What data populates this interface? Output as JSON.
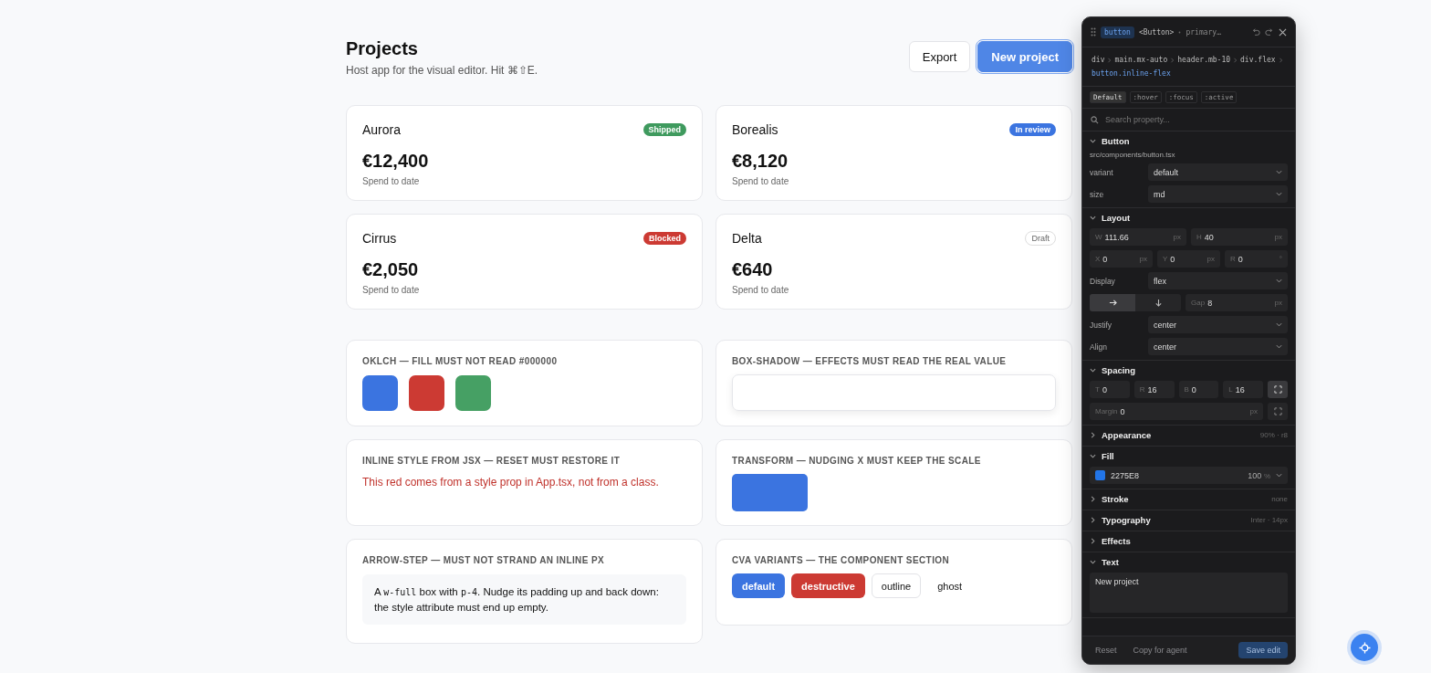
{
  "header": {
    "title": "Projects",
    "subtitle": "Host app for the visual editor. Hit ⌘⇧E.",
    "buttons": [
      {
        "label": "Export",
        "kind": "secondary",
        "selected": false
      },
      {
        "label": "New project",
        "kind": "primary",
        "selected": true
      }
    ]
  },
  "projects": [
    {
      "name": "Aurora",
      "status": "Shipped",
      "color": "#3f9a5e",
      "amount": "€12,400",
      "caption": "Spend to date"
    },
    {
      "name": "Borealis",
      "status": "In review",
      "color": "#3b74e0",
      "amount": "€8,120",
      "caption": "Spend to date"
    },
    {
      "name": "Cirrus",
      "status": "Blocked",
      "color": "#cc3a33",
      "amount": "€2,050",
      "caption": "Spend to date"
    },
    {
      "name": "Delta",
      "status": "Draft",
      "color": "#ffffff",
      "amount": "€640",
      "caption": "Spend to date"
    }
  ],
  "tests": [
    {
      "title": "OKLCH — FILL MUST NOT READ #000000",
      "kind": "swatches",
      "swatches": [
        {
          "color": "#3b74e0"
        },
        {
          "color": "#cc3a33"
        },
        {
          "color": "#46a064"
        }
      ]
    },
    {
      "title": "BOX-SHADOW — EFFECTS MUST READ THE REAL VALUE",
      "kind": "shadow"
    },
    {
      "title": "INLINE STYLE FROM JSX — RESET MUST RESTORE IT",
      "kind": "red-text",
      "text": "This red comes from a style prop in App.tsx, not from a class."
    },
    {
      "title": "TRANSFORM — NUDGING X MUST KEEP THE SCALE",
      "kind": "transform"
    },
    {
      "title": "ARROW-STEP — MUST NOT STRAND AN INLINE PX",
      "kind": "note",
      "parts": [
        {
          "kind": "text",
          "text": "A "
        },
        {
          "kind": "code",
          "text": "w-full"
        },
        {
          "kind": "text",
          "text": " box with "
        },
        {
          "kind": "code",
          "text": "p-4"
        },
        {
          "kind": "text",
          "text": ". Nudge its padding up and back down: the style attribute must end up empty."
        }
      ]
    },
    {
      "title": "CVA VARIANTS — THE COMPONENT SECTION",
      "kind": "variants",
      "variants": [
        {
          "label": "default",
          "kind": "default"
        },
        {
          "label": "destructive",
          "kind": "destructive"
        },
        {
          "label": "outline",
          "kind": "outline"
        },
        {
          "label": "ghost",
          "kind": "ghost"
        }
      ]
    }
  ],
  "inspector": {
    "tag": "button",
    "component": "<Button>",
    "variant_hint": "primary…",
    "breadcrumb": [
      {
        "label": "div",
        "current": false
      },
      {
        "label": "main.mx-auto",
        "current": false
      },
      {
        "label": "header.mb-10",
        "current": false
      },
      {
        "label": "div.flex",
        "current": false
      },
      {
        "label": "button.inline-flex",
        "current": true
      }
    ],
    "states": [
      {
        "label": "Default",
        "selected": true
      },
      {
        "label": ":hover",
        "selected": false
      },
      {
        "label": ":focus",
        "selected": false
      },
      {
        "label": ":active",
        "selected": false
      }
    ],
    "search_placeholder": "Search property...",
    "sections": [
      {
        "kind": "props",
        "title": "Button",
        "expanded": true,
        "file": "src/components/button.tsx",
        "rows": [
          {
            "label": "variant",
            "value": "default"
          },
          {
            "label": "size",
            "value": "md"
          }
        ]
      },
      {
        "kind": "layout",
        "title": "Layout",
        "expanded": true,
        "size": [
          {
            "label": "W",
            "value": "111.66",
            "unit": "px"
          },
          {
            "label": "H",
            "value": "40",
            "unit": "px"
          }
        ],
        "position": [
          {
            "label": "X",
            "value": "0",
            "unit": "px"
          },
          {
            "label": "Y",
            "value": "0",
            "unit": "px"
          },
          {
            "label": "R",
            "value": "0",
            "unit": "°"
          }
        ],
        "display": {
          "label": "Display",
          "value": "flex"
        },
        "direction": [
          {
            "kind": "row",
            "selected": true
          },
          {
            "kind": "column",
            "selected": false
          }
        ],
        "gap": {
          "label": "Gap",
          "value": "8",
          "unit": "px"
        },
        "rows": [
          {
            "label": "Justify",
            "value": "center"
          },
          {
            "label": "Align",
            "value": "center"
          }
        ]
      },
      {
        "kind": "spacing",
        "title": "Spacing",
        "expanded": true,
        "padding": [
          {
            "label": "T",
            "value": "0"
          },
          {
            "label": "R",
            "value": "16"
          },
          {
            "label": "B",
            "value": "0"
          },
          {
            "label": "L",
            "value": "16"
          }
        ],
        "margin": {
          "label": "Margin",
          "value": "0",
          "unit": "px"
        }
      },
      {
        "kind": "summary",
        "title": "Appearance",
        "expanded": false,
        "summary": "90% · r8"
      },
      {
        "kind": "fill",
        "title": "Fill",
        "expanded": true,
        "color": "#2275e8",
        "hex": "2275E8",
        "opacity": "100",
        "unit": "%"
      },
      {
        "kind": "summary",
        "title": "Stroke",
        "expanded": false,
        "summary": "none"
      },
      {
        "kind": "summary",
        "title": "Typography",
        "expanded": false,
        "summary": "Inter · 14px"
      },
      {
        "kind": "summary",
        "title": "Effects",
        "expanded": false
      },
      {
        "kind": "text",
        "title": "Text",
        "expanded": true,
        "value": "New project"
      }
    ],
    "footer": [
      {
        "label": "Reset",
        "kind": "plain",
        "disabled": true
      },
      {
        "label": "Copy for agent",
        "kind": "plain",
        "disabled": true
      },
      {
        "label": "Save edit",
        "kind": "primary",
        "disabled": true
      }
    ]
  }
}
